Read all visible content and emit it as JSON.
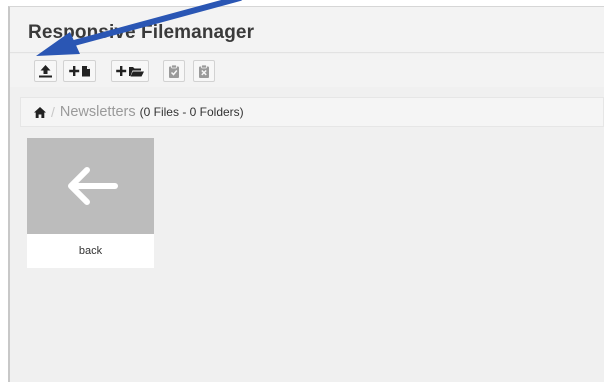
{
  "app": {
    "title": "Responsive Filemanager"
  },
  "toolbar": {
    "buttons": [
      {
        "icon": "upload-icon"
      },
      {
        "icon": "new-file-icon"
      },
      {
        "icon": "new-folder-icon"
      },
      {
        "icon": "clipboard-paste-icon"
      },
      {
        "icon": "clear-clipboard-icon"
      }
    ]
  },
  "breadcrumb": {
    "home_icon": "home-icon",
    "separator": "/",
    "folder": "Newsletters",
    "counts": "(0 Files - 0 Folders)"
  },
  "items": [
    {
      "label": "back",
      "icon": "arrow-left-icon"
    }
  ],
  "colors": {
    "annotation_arrow": "#2a56b4",
    "thumb_bg": "#bcbcbc",
    "panel_bg": "#f0f0f0"
  }
}
